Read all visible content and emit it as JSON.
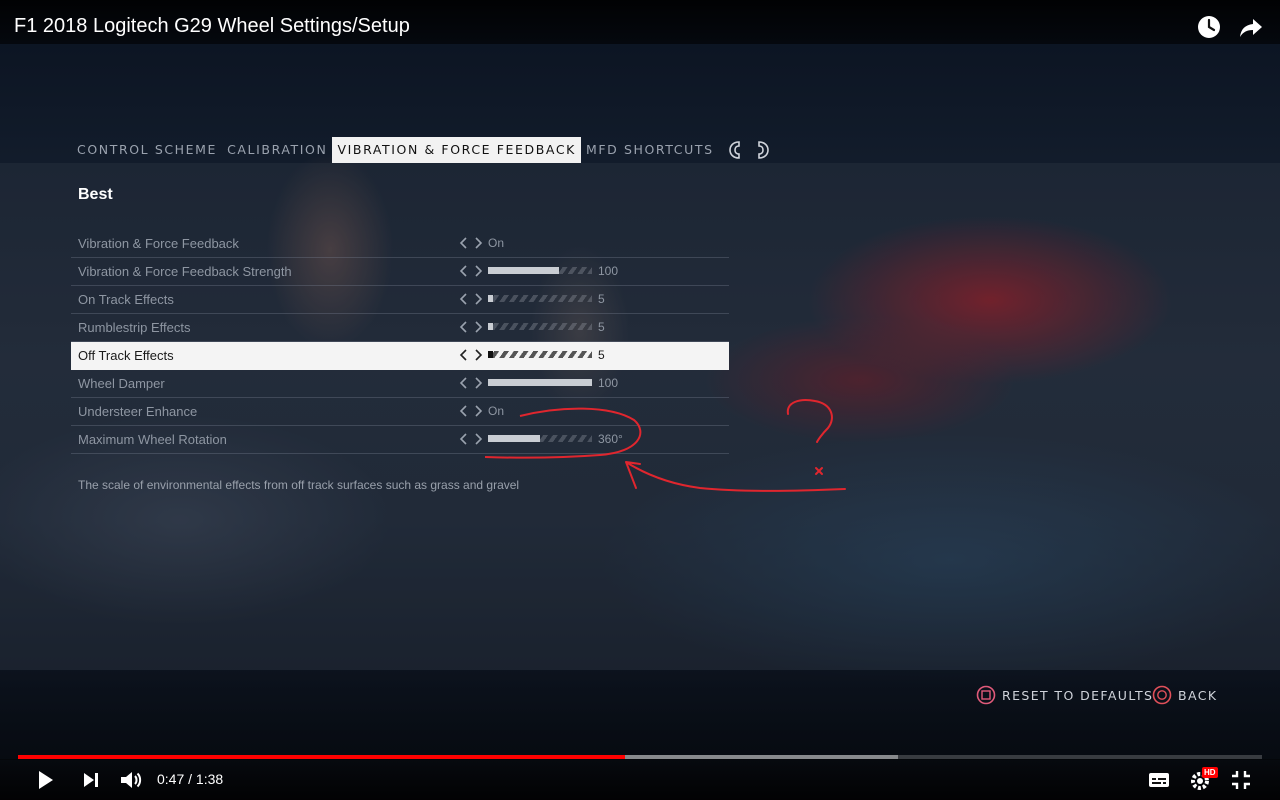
{
  "video": {
    "title": "F1 2018 Logitech G29 Wheel Settings/Setup",
    "top_icons": [
      "clock-icon",
      "share-icon"
    ],
    "progress": {
      "played_fraction": 0.488,
      "loaded_fraction": 0.707
    },
    "time": {
      "current": "0:47",
      "duration": "1:38",
      "separator": "/"
    },
    "hd_badge": "HD"
  },
  "game": {
    "tabs": [
      {
        "label": "CONTROL SCHEME",
        "active": false
      },
      {
        "label": "CALIBRATION",
        "active": false
      },
      {
        "label": "VIBRATION & FORCE FEEDBACK",
        "active": true
      },
      {
        "label": "MFD SHORTCUTS",
        "active": false
      }
    ],
    "section_title": "Best",
    "settings": [
      {
        "label": "Vibration & Force Feedback",
        "value": "On"
      },
      {
        "label": "Vibration & Force Feedback Strength",
        "value": "100",
        "level": 0.68
      },
      {
        "label": "On Track Effects",
        "value": "5",
        "level": 0.05
      },
      {
        "label": "Rumblestrip Effects",
        "value": "5",
        "level": 0.05
      },
      {
        "label": "Off Track Effects",
        "value": "5",
        "level": 0.05,
        "selected": true
      },
      {
        "label": "Wheel Damper",
        "value": "100",
        "level": 1.0
      },
      {
        "label": "Understeer Enhance",
        "value": "On"
      },
      {
        "label": "Maximum Wheel Rotation",
        "value": "360°",
        "level": 0.5
      }
    ],
    "description": "The scale of environmental effects from off track surfaces such as grass and gravel",
    "footer": {
      "reset_label": "RESET TO DEFAULTS",
      "back_label": "BACK"
    }
  },
  "colors": {
    "accent_red": "#ff0000",
    "annotation_red": "#e0262e",
    "selected_row": "#f4f4f4"
  }
}
